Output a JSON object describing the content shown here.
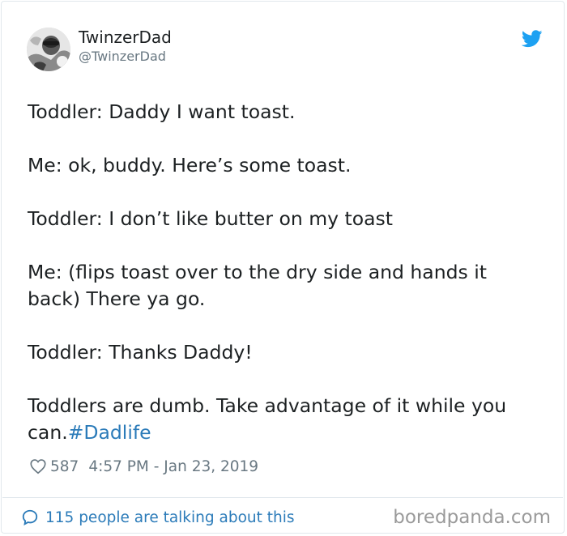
{
  "author": {
    "display_name": "TwinzerDad",
    "handle": "@TwinzerDad"
  },
  "tweet": {
    "paragraphs": [
      "Toddler: Daddy I want toast.",
      "Me: ok, buddy. Here’s some toast.",
      "Toddler: I don’t like butter on my toast",
      "Me: (flips toast over to the dry side and hands it back) There ya go.",
      "Toddler: Thanks Daddy!",
      "Toddlers are dumb. Take advantage of it while you can."
    ],
    "hashtag": "#Dadlife"
  },
  "meta": {
    "likes": "587",
    "timestamp": "4:57 PM - Jan 23, 2019"
  },
  "footer": {
    "talking_link": "115 people are talking about this",
    "watermark": "boredpanda.com"
  },
  "colors": {
    "accent": "#2b7bb9",
    "twitter_blue": "#1da1f2",
    "muted_text": "#697882",
    "body_text": "#1c2022",
    "border": "#e1e8ed"
  },
  "icons": {
    "brand": "twitter-bird-icon",
    "like": "heart-icon",
    "reply": "speech-bubble-icon"
  }
}
